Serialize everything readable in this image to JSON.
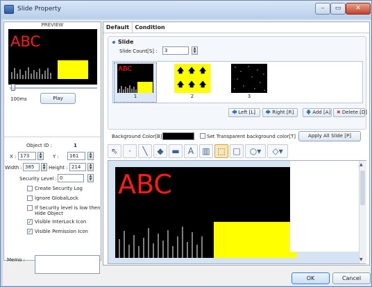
{
  "window": {
    "title": "Slide Property",
    "caption_buttons": {
      "minimize": "–",
      "maximize": "▭",
      "close": "✕"
    }
  },
  "left_panel": {
    "preview_title": "PREVIEW",
    "preview_text": "ABC",
    "speed_label": "100ms",
    "play_label": "Play",
    "object_id_label": "Object ID :",
    "object_id_value": "1",
    "x_label": "X :",
    "x_value": "173",
    "y_label": "Y :",
    "y_value": "161",
    "width_label": "Width :",
    "width_value": "385",
    "height_label": "Height :",
    "height_value": "214",
    "security_level_label": "Security Level :",
    "security_level_value": "0",
    "checkboxes": [
      {
        "label": "Create Security Log",
        "checked": false
      },
      {
        "label": "Ignore GlobalLock",
        "checked": false
      },
      {
        "label": "If Security level is low then",
        "label2": "Hide Object",
        "checked": false
      },
      {
        "label": "Visible InterLock Icon",
        "checked": true
      },
      {
        "label": "Visible Pemission Icon",
        "checked": true
      }
    ],
    "memo_label": "Memo :"
  },
  "tabs": [
    {
      "label": "Default",
      "active": true
    },
    {
      "label": "Condition",
      "active": false
    }
  ],
  "slide": {
    "header": "Slide",
    "count_label": "Slide Count[S] :",
    "count_value": "3",
    "thumbnails": [
      {
        "number": "1",
        "text": "ABC"
      },
      {
        "number": "2"
      },
      {
        "number": "3"
      }
    ],
    "buttons": {
      "left": "Left [L]",
      "right": "Right [R]",
      "add": "Add [A]",
      "delete": "Delete [D]"
    }
  },
  "background": {
    "color_label": "Background Color[B] :",
    "color_value": "#000000",
    "transparent_label": "Set Transparent background color[T]",
    "apply_all_label": "Apply All Slide [P]"
  },
  "toolbar_icons": [
    "pointer-icon",
    "point-icon",
    "line-icon",
    "fill-icon",
    "image-icon",
    "text-icon",
    "bar-graph-icon",
    "select-region-icon",
    "rectangle-icon",
    "ellipse-dropdown-icon",
    "polygon-dropdown-icon"
  ],
  "canvas": {
    "text": "ABC"
  },
  "footer": {
    "ok_label": "OK",
    "cancel_label": "Cancel"
  },
  "colors": {
    "abc_red": "#ff1a1a",
    "yellow": "#ffff00",
    "canvas_black": "#000000"
  }
}
